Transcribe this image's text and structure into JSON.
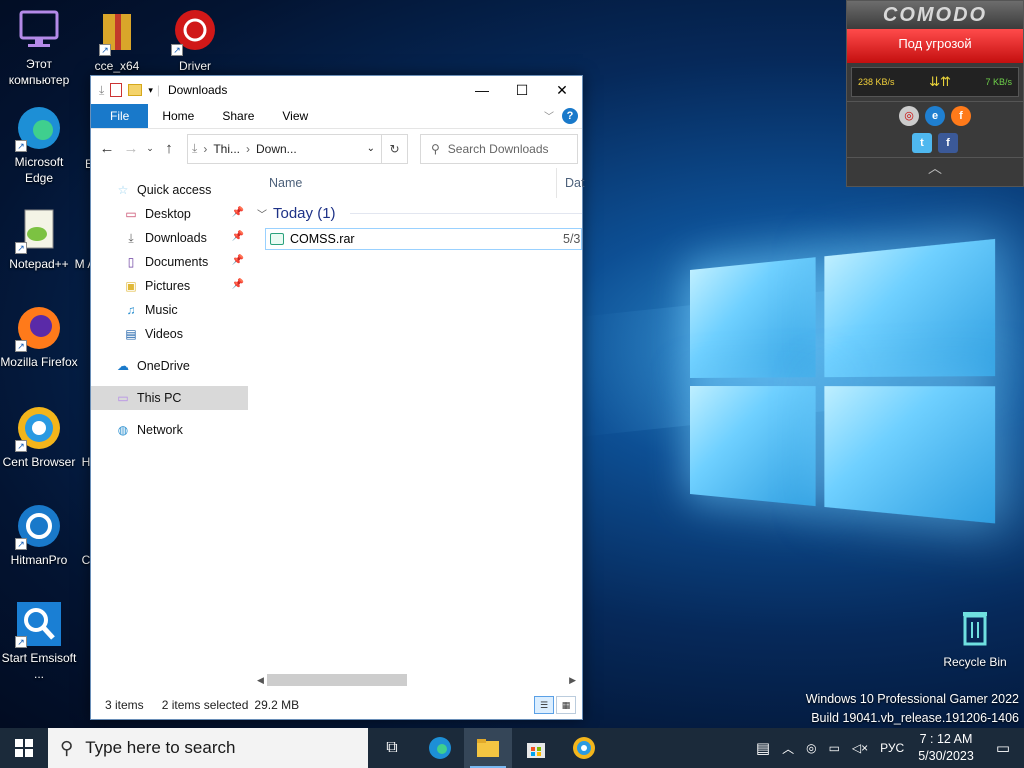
{
  "desktop": {
    "icons": [
      {
        "label": "Этот компьютер"
      },
      {
        "label": "cce_x64"
      },
      {
        "label": "Driver"
      },
      {
        "label": "Microsoft Edge"
      },
      {
        "label": "E"
      },
      {
        "label": "Notepad++"
      },
      {
        "label": "M A"
      },
      {
        "label": "Mozilla Firefox"
      },
      {
        "label": "Cent Browser"
      },
      {
        "label": "H"
      },
      {
        "label": "HitmanPro"
      },
      {
        "label": "C"
      },
      {
        "label": "Start Emsisoft ..."
      },
      {
        "label": "Recycle Bin"
      }
    ]
  },
  "explorer": {
    "title": "Downloads",
    "ribbon_tabs": {
      "file": "File",
      "home": "Home",
      "share": "Share",
      "view": "View"
    },
    "help": "?",
    "address": {
      "part1": "Thi...",
      "part2": "Down..."
    },
    "search_placeholder": "Search Downloads",
    "nav": {
      "quick_access": "Quick access",
      "desktop": "Desktop",
      "downloads": "Downloads",
      "documents": "Documents",
      "pictures": "Pictures",
      "music": "Music",
      "videos": "Videos",
      "onedrive": "OneDrive",
      "thispc": "This PC",
      "network": "Network"
    },
    "columns": {
      "name": "Name",
      "date": "Dat"
    },
    "group": "Today (1)",
    "files": [
      {
        "name": "COMSS.rar",
        "date": "5/3"
      }
    ],
    "status": {
      "items": "3 items",
      "selected": "2 items selected",
      "size": "29.2 MB"
    }
  },
  "comodo": {
    "brand": "COMODO",
    "alert": "Под угрозой",
    "download_speed": "238 KB/s",
    "upload_speed": "7 KB/s"
  },
  "build": {
    "line1": "Windows 10 Professional Gamer 2022",
    "line2": "Build 19041.vb_release.191206-1406"
  },
  "taskbar": {
    "search_placeholder": "Type here to search",
    "lang": "РУС",
    "time": "7 : 12 AM",
    "date": "5/30/2023"
  }
}
